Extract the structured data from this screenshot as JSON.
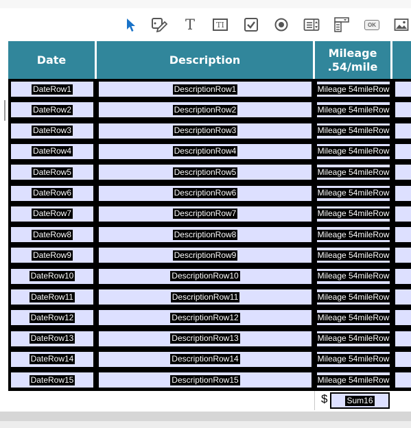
{
  "toolbar": {
    "tools": [
      {
        "name": "select-tool"
      },
      {
        "name": "edit-fields-tool"
      },
      {
        "name": "text-tool",
        "glyph": "T"
      },
      {
        "name": "text-field-tool",
        "glyph": "TI"
      },
      {
        "name": "checkbox-tool"
      },
      {
        "name": "radio-button-tool"
      },
      {
        "name": "list-box-tool"
      },
      {
        "name": "dropdown-tool"
      },
      {
        "name": "button-tool",
        "glyph": "OK"
      },
      {
        "name": "image-tool"
      }
    ],
    "accent": "#1a73c8"
  },
  "table": {
    "header_color": "#31869b",
    "field_color": "#dde0ff",
    "headers": {
      "date": "Date",
      "description": "Description",
      "mileage_line1": "Mileage",
      "mileage_line2": ".54/mile"
    },
    "rows": [
      {
        "date": "DateRow1",
        "description": "DescriptionRow1",
        "mileage": "Mileage 54mileRow"
      },
      {
        "date": "DateRow2",
        "description": "DescriptionRow2",
        "mileage": "Mileage 54mileRow"
      },
      {
        "date": "DateRow3",
        "description": "DescriptionRow3",
        "mileage": "Mileage 54mileRow"
      },
      {
        "date": "DateRow4",
        "description": "DescriptionRow4",
        "mileage": "Mileage 54mileRow"
      },
      {
        "date": "DateRow5",
        "description": "DescriptionRow5",
        "mileage": "Mileage 54mileRow"
      },
      {
        "date": "DateRow6",
        "description": "DescriptionRow6",
        "mileage": "Mileage 54mileRow"
      },
      {
        "date": "DateRow7",
        "description": "DescriptionRow7",
        "mileage": "Mileage 54mileRow"
      },
      {
        "date": "DateRow8",
        "description": "DescriptionRow8",
        "mileage": "Mileage 54mileRow"
      },
      {
        "date": "DateRow9",
        "description": "DescriptionRow9",
        "mileage": "Mileage 54mileRow"
      },
      {
        "date": "DateRow10",
        "description": "DescriptionRow10",
        "mileage": "Mileage 54mileRow"
      },
      {
        "date": "DateRow11",
        "description": "DescriptionRow11",
        "mileage": "Mileage 54mileRow"
      },
      {
        "date": "DateRow12",
        "description": "DescriptionRow12",
        "mileage": "Mileage 54mileRow"
      },
      {
        "date": "DateRow13",
        "description": "DescriptionRow13",
        "mileage": "Mileage 54mileRow"
      },
      {
        "date": "DateRow14",
        "description": "DescriptionRow14",
        "mileage": "Mileage 54mileRow"
      },
      {
        "date": "DateRow15",
        "description": "DescriptionRow15",
        "mileage": "Mileage 54mileRow"
      }
    ],
    "sum": {
      "currency": "$",
      "field": "Sum16"
    }
  }
}
